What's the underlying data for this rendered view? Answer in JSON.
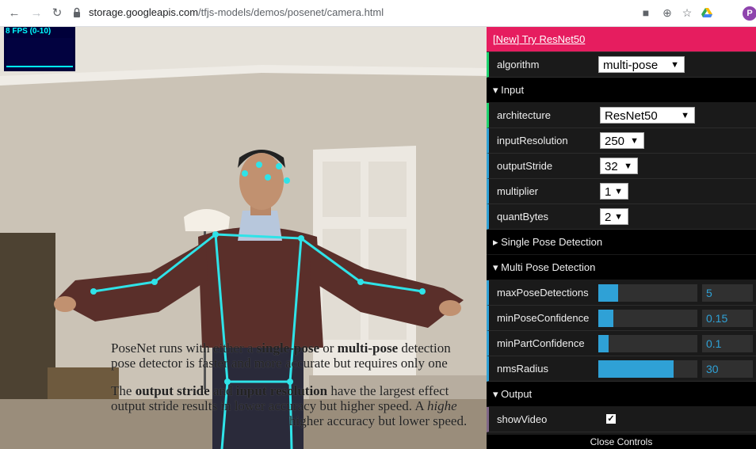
{
  "browser": {
    "url_host": "storage.googleapis.com",
    "url_path": "/tfjs-models/demos/posenet/camera.html",
    "profile_initial": "P"
  },
  "stats": {
    "fps_label": "8 FPS (0-10)"
  },
  "info": {
    "p1_a": "PoseNet runs with either a ",
    "p1_b": "single-pose",
    "p1_c": " or ",
    "p1_d": "multi-pose",
    "p1_e": " detection",
    "p1_line2": "pose detector is faster and more accurate but requires only one",
    "p2_a": "The ",
    "p2_b": "output stride",
    "p2_c": " and ",
    "p2_d": "input resolution",
    "p2_e": " have the largest effect",
    "p2_line2_a": "output stride results in lower accuracy but higher speed. A ",
    "p2_line2_b": "highe",
    "p2_line3": "higher accuracy but lower speed."
  },
  "gui": {
    "link_label": "[New] Try ResNet50",
    "algorithm": {
      "label": "algorithm",
      "value": "multi-pose"
    },
    "input_folder": "Input",
    "architecture": {
      "label": "architecture",
      "value": "ResNet50"
    },
    "inputResolution": {
      "label": "inputResolution",
      "value": "250"
    },
    "outputStride": {
      "label": "outputStride",
      "value": "32"
    },
    "multiplier": {
      "label": "multiplier",
      "value": "1"
    },
    "quantBytes": {
      "label": "quantBytes",
      "value": "2"
    },
    "single_folder": "Single Pose Detection",
    "multi_folder": "Multi Pose Detection",
    "maxPoseDetections": {
      "label": "maxPoseDetections",
      "value": "5",
      "fill": 0.2
    },
    "minPoseConfidence": {
      "label": "minPoseConfidence",
      "value": "0.15",
      "fill": 0.15
    },
    "minPartConfidence": {
      "label": "minPartConfidence",
      "value": "0.1",
      "fill": 0.1
    },
    "nmsRadius": {
      "label": "nmsRadius",
      "value": "30",
      "fill": 0.76
    },
    "output_folder": "Output",
    "showVideo": {
      "label": "showVideo",
      "checked": true
    },
    "close_label": "Close Controls"
  },
  "colors": {
    "skeleton": "#2fe3e8",
    "link_bg": "#e61d5f",
    "number_accent": "#2fa1d6",
    "string_accent": "#1ed36f"
  }
}
